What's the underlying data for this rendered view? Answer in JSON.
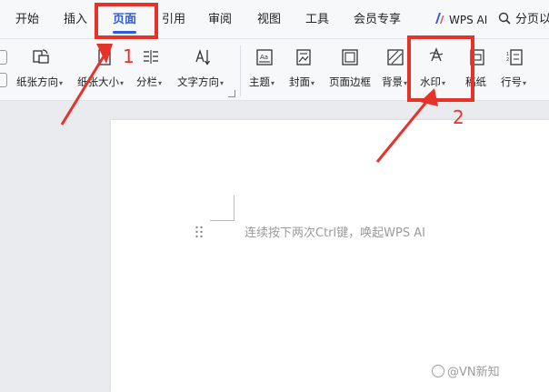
{
  "menu": {
    "tabs": [
      {
        "label": "开始"
      },
      {
        "label": "插入"
      },
      {
        "label": "页面"
      },
      {
        "label": "引用"
      },
      {
        "label": "审阅"
      },
      {
        "label": "视图"
      },
      {
        "label": "工具"
      },
      {
        "label": "会员专享"
      }
    ],
    "active_tab": "页面",
    "wps_ai_label": "WPS AI",
    "search_label": "分页以"
  },
  "ribbon": {
    "paper_direction": "纸张方向",
    "paper_size": "纸张大小",
    "columns": "分栏",
    "text_direction": "文字方向",
    "theme": "主题",
    "cover": "封面",
    "page_border": "页面边框",
    "background": "背景",
    "watermark": "水印",
    "manuscript": "稿纸",
    "line_number": "行号"
  },
  "document": {
    "placeholder": "连续按下两次Ctrl键，唤起WPS AI"
  },
  "annotations": {
    "step1": "1",
    "step2": "2",
    "color": "#e5332a"
  },
  "watermark_text": "@VN新知",
  "colors": {
    "accent": "#2d5ae0",
    "annotation": "#e5332a"
  }
}
